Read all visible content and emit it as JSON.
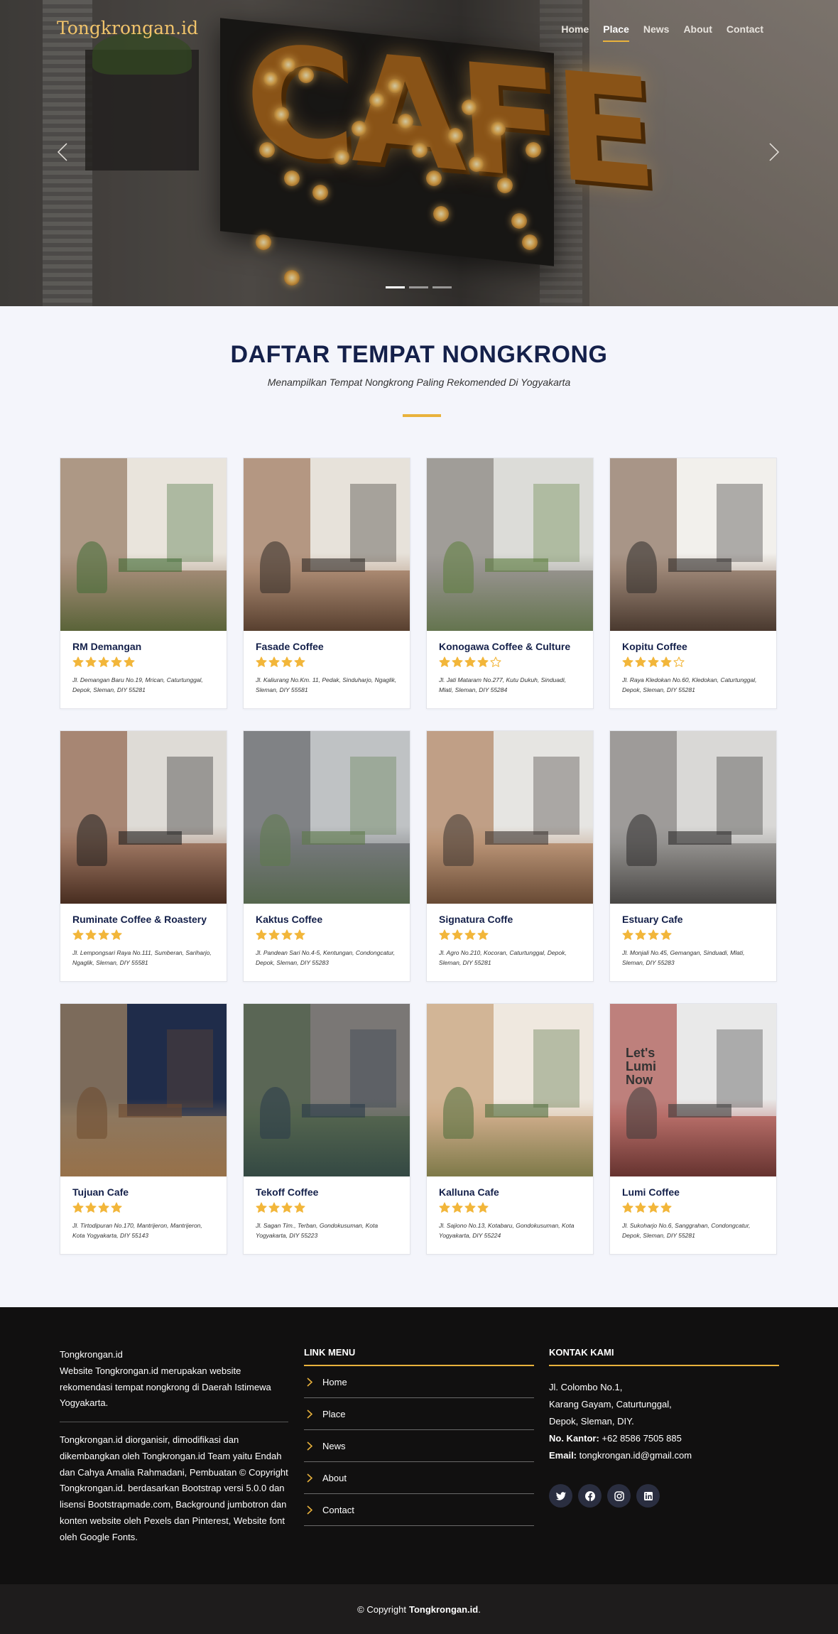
{
  "brand": "Tongkrongan.id",
  "nav": [
    {
      "label": "Home",
      "active": false
    },
    {
      "label": "Place",
      "active": true
    },
    {
      "label": "News",
      "active": false
    },
    {
      "label": "About",
      "active": false
    },
    {
      "label": "Contact",
      "active": false
    }
  ],
  "hero": {
    "sign_text": "CAFE",
    "slides": 3,
    "active_slide": 1
  },
  "section": {
    "title": "DAFTAR TEMPAT NONGKRONG",
    "subtitle": "Menampilkan Tempat Nongkrong Paling Rekomended Di Yogyakarta"
  },
  "places": [
    {
      "name": "RM Demangan",
      "rating": 5,
      "address": "Jl. Demangan Baru No.19, Mrican, Caturtunggal, Depok, Sleman, DIY 55281",
      "palette": [
        "#e9e4dc",
        "#7b5a3e",
        "#3f6b34"
      ]
    },
    {
      "name": "Fasade Coffee",
      "rating": 4,
      "address": "Jl. Kaliurang No.Km. 11, Pedak, Sinduharjo, Ngaglik, Sleman, DIY 55581",
      "palette": [
        "#e7e2da",
        "#8a5a3a",
        "#2f2a26"
      ]
    },
    {
      "name": "Konogawa Coffee & Culture",
      "rating": 4,
      "max": 5,
      "address": "Jl. Jati Mataram No.277, Kutu Dukuh, Sinduadi, Mlati, Sleman, DIY 55284",
      "palette": [
        "#dcdcd8",
        "#6f6a64",
        "#5c7d3d"
      ]
    },
    {
      "name": "Kopitu Coffee",
      "rating": 4,
      "max": 5,
      "address": "Jl. Raya Kledokan No.60, Kledokan, Caturtunggal, Depok, Sleman, DIY 55281",
      "palette": [
        "#f2f0ec",
        "#6b4a34",
        "#2e2b2a"
      ]
    },
    {
      "name": "Ruminate Coffee & Roastery",
      "rating": 4,
      "address": "Jl. Lempongsari Raya No.111, Sumberan, Sariharjo, Ngaglik, Sleman, DIY 55581",
      "palette": [
        "#dedbd6",
        "#7a3f22",
        "#1e1e1e"
      ]
    },
    {
      "name": "Kaktus Coffee",
      "rating": 4,
      "address": "Jl. Pandean Sari No.4-5, Kentungan, Condongcatur, Depok, Sleman, DIY 55283",
      "palette": [
        "#bfc2c4",
        "#4c4f52",
        "#5d7a4a"
      ]
    },
    {
      "name": "Signatura Coffe",
      "rating": 4,
      "address": "Jl. Agro No.210, Kocoran, Caturtunggal, Depok, Sleman, DIY 55281",
      "palette": [
        "#e6e5e2",
        "#a0663a",
        "#3a3330"
      ]
    },
    {
      "name": "Estuary Cafe",
      "rating": 4,
      "address": "Jl. Monjali No.45, Gemangan, Sinduadi, Mlati, Sleman, DIY 55283",
      "palette": [
        "#d9d8d6",
        "#6d6a67",
        "#2b2a29"
      ]
    },
    {
      "name": "Tujuan Cafe",
      "rating": 4,
      "address": "Jl. Tirtodipuran No.170, Mantrijeron, Mantrijeron, Kota Yogyakarta, DIY 55143",
      "palette": [
        "#1f2c4a",
        "#c9a06a",
        "#6e4a2e"
      ]
    },
    {
      "name": "Tekoff Coffee",
      "rating": 4,
      "address": "Jl. Sagan Tim., Terban, Gondokusuman, Kota Yogyakarta, DIY 55223",
      "palette": [
        "#7a7775",
        "#3f5a3a",
        "#2a3a4a"
      ]
    },
    {
      "name": "Kalluna Cafe",
      "rating": 4,
      "address": "Jl. Sajiono No.13, Kotabaru, Gondokusuman, Kota Yogyakarta, DIY 55224",
      "palette": [
        "#efe8df",
        "#b98a5a",
        "#4d6b3a"
      ]
    },
    {
      "name": "Lumi Coffee",
      "rating": 4,
      "address": "Jl. Sukoharjo No.6, Sanggrahan, Condongcatur, Depok, Sleman, DIY 55281",
      "palette": [
        "#e9e9e9",
        "#9b2a22",
        "#3a3a3a"
      ],
      "sign": "Let's Lumi Now"
    }
  ],
  "footer": {
    "about_title": "Tongkrongan.id",
    "about_text": "Website Tongkrongan.id merupakan website rekomendasi tempat nongkrong di Daerah Istimewa Yogyakarta.",
    "credits": "Tongkrongan.id diorganisir, dimodifikasi dan dikembangkan oleh Tongkrongan.id Team yaitu Endah dan Cahya Amalia Rahmadani, Pembuatan © Copyright Tongkrongan.id. berdasarkan Bootstrap versi 5.0.0 dan lisensi Bootstrapmade.com, Background jumbotron dan konten website oleh Pexels dan Pinterest, Website font oleh Google Fonts.",
    "link_heading": "LINK MENU",
    "links": [
      "Home",
      "Place",
      "News",
      "About",
      "Contact"
    ],
    "contact_heading": "KONTAK KAMI",
    "address1": "Jl. Colombo No.1,",
    "address2": "Karang Gayam, Caturtunggal,",
    "address3": "Depok, Sleman, DIY.",
    "phone_label": "No. Kantor:",
    "phone": "+62 8586 7505 885",
    "email_label": "Email:",
    "email": "tongkrongan.id@gmail.com",
    "socials": [
      "twitter-icon",
      "facebook-icon",
      "instagram-icon",
      "linkedin-icon"
    ],
    "copyright_prefix": "© Copyright",
    "copyright_brand": "Tongkrongan.id",
    "copyright_suffix": "."
  },
  "colors": {
    "accent": "#e9b23c",
    "navy": "#14204a",
    "footer_bg": "#111010",
    "star": "#f2b63a"
  }
}
